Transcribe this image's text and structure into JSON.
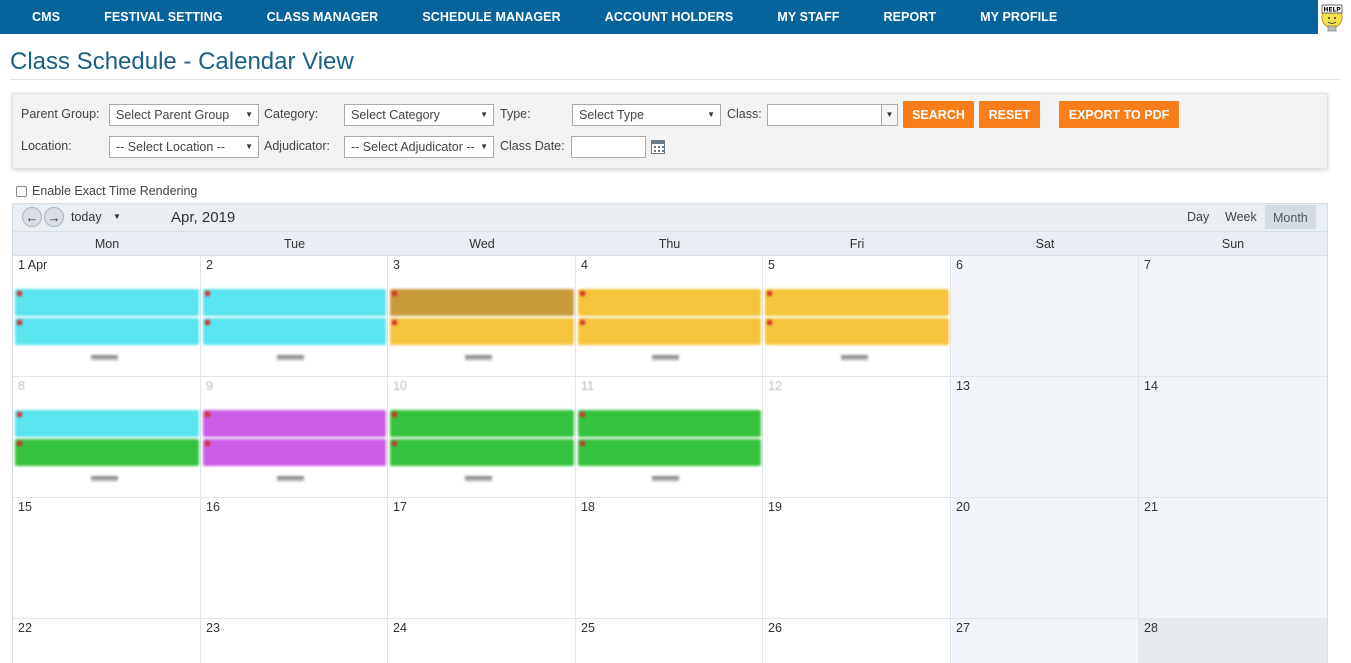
{
  "nav": {
    "items": [
      "CMS",
      "FESTIVAL SETTING",
      "CLASS MANAGER",
      "SCHEDULE MANAGER",
      "ACCOUNT HOLDERS",
      "MY STAFF",
      "REPORT",
      "MY PROFILE"
    ],
    "help_label": "HELP"
  },
  "page": {
    "title": "Class Schedule - Calendar View"
  },
  "filters": {
    "parent_group_label": "Parent Group:",
    "parent_group_value": "Select Parent Group",
    "category_label": "Category:",
    "category_value": "Select Category",
    "type_label": "Type:",
    "type_value": "Select Type",
    "class_label": "Class:",
    "class_value": "",
    "location_label": "Location:",
    "location_value": "-- Select Location --",
    "adjudicator_label": "Adjudicator:",
    "adjudicator_value": "-- Select Adjudicator --",
    "class_date_label": "Class Date:",
    "class_date_value": "",
    "search_label": "SEARCH",
    "reset_label": "RESET",
    "export_label": "EXPORT TO PDF"
  },
  "exact_time": {
    "label": "Enable Exact Time Rendering",
    "checked": false
  },
  "toolbar": {
    "today_label": "today",
    "month_title": "Apr, 2019",
    "views": [
      "Day",
      "Week",
      "Month"
    ],
    "active_view": "Month"
  },
  "calendar": {
    "weekdays": [
      "Mon",
      "Tue",
      "Wed",
      "Thu",
      "Fri",
      "Sat",
      "Sun"
    ],
    "weeks": [
      [
        "1 Apr",
        "2",
        "3",
        "4",
        "5",
        "6",
        "7"
      ],
      [
        "8",
        "9",
        "10",
        "11",
        "12",
        "13",
        "14"
      ],
      [
        "15",
        "16",
        "17",
        "18",
        "19",
        "20",
        "21"
      ],
      [
        "22",
        "23",
        "24",
        "25",
        "26",
        "27",
        "28"
      ]
    ]
  },
  "colors": {
    "nav_bg": "#06639c",
    "button": "#f77e19",
    "event_cyan": "#59e4ee",
    "event_gold": "#f5c43c",
    "event_purple": "#cc5ce6",
    "event_green": "#35c23d"
  },
  "icons": {
    "prev": "arrow-left-icon",
    "next": "arrow-right-icon",
    "calendar": "calendar-icon",
    "help": "help-bulb-icon",
    "dropdown": "caret-down-icon"
  }
}
